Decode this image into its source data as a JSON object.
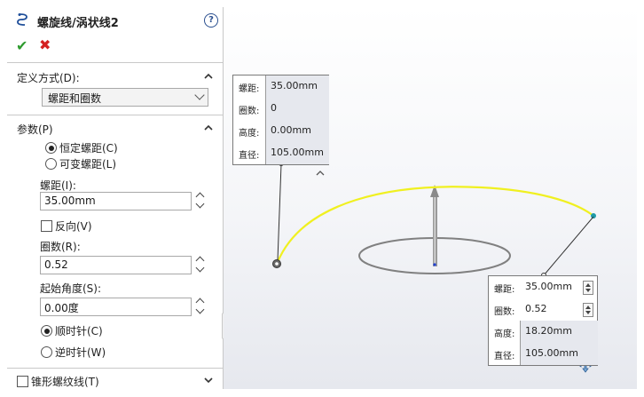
{
  "panel": {
    "title": "螺旋线/涡状线2",
    "help_icon": "help-icon",
    "ok_icon": "check-icon",
    "cancel_icon": "close-icon",
    "definition": {
      "header": "定义方式(D):",
      "selected": "螺距和圈数"
    },
    "parameters": {
      "header": "参数(P)",
      "constant_pitch": "恒定螺距(C)",
      "variable_pitch": "可变螺距(L)",
      "pitch_label": "螺距(I):",
      "pitch_value": "35.00mm",
      "reverse_label": "反向(V)",
      "revolutions_label": "圈数(R):",
      "revolutions_value": "0.52",
      "start_angle_label": "起始角度(S):",
      "start_angle_value": "0.00度",
      "clockwise": "顺时针(C)",
      "counterclockwise": "逆时针(W)"
    },
    "taper": {
      "header": "锥形螺纹线(T)"
    }
  },
  "callout_start": {
    "rows": [
      {
        "label": "螺距:",
        "value": "35.00mm"
      },
      {
        "label": "圈数:",
        "value": "0"
      },
      {
        "label": "高度:",
        "value": "0.00mm"
      },
      {
        "label": "直径:",
        "value": "105.00mm"
      }
    ]
  },
  "callout_end": {
    "rows": [
      {
        "label": "螺距:",
        "value": "35.00mm"
      },
      {
        "label": "圈数:",
        "value": "0.52"
      },
      {
        "label": "高度:",
        "value": "18.20mm"
      },
      {
        "label": "直径:",
        "value": "105.00mm"
      }
    ]
  },
  "colors": {
    "helix": "#f0f020",
    "ok": "#2e9b2e",
    "cancel": "#d42020"
  }
}
